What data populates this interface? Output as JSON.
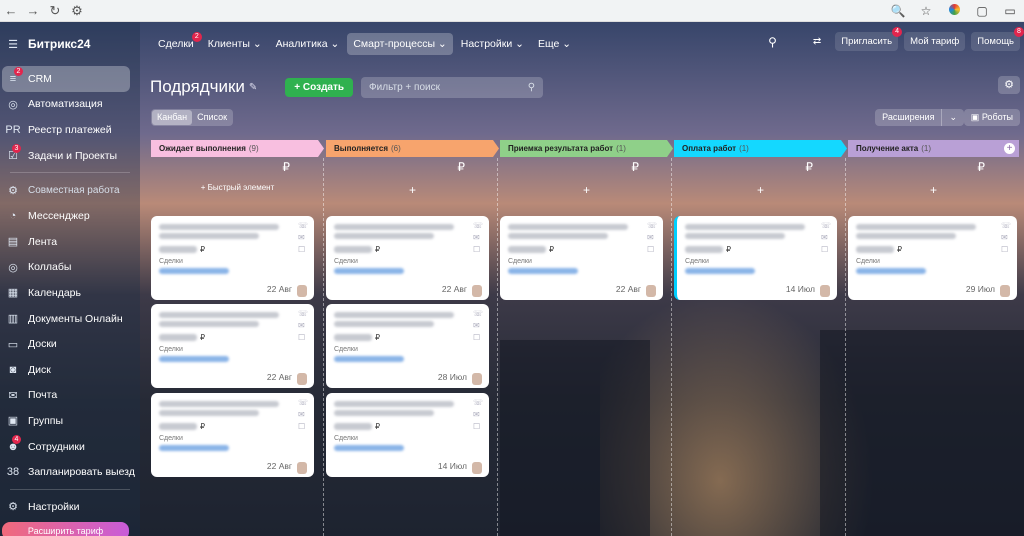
{
  "browser": {
    "back": "←",
    "forward": "→",
    "reload": "↻",
    "tune": "⚙",
    "zoom": "🔍",
    "star": "☆",
    "puzzle": "▢",
    "panel": "▭"
  },
  "logo": "Битрикс24",
  "sidebar": {
    "items": [
      {
        "label": "CRM",
        "icon": "≡",
        "badge": "2"
      },
      {
        "label": "Автоматизация",
        "icon": "◎",
        "badge": ""
      },
      {
        "label": "Реестр платежей",
        "icon": "PR",
        "badge": ""
      },
      {
        "label": "Задачи и Проекты",
        "icon": "☑",
        "badge": "3"
      }
    ],
    "section": "Совместная работа",
    "items2": [
      {
        "label": "Мессенджер",
        "icon": "◔"
      },
      {
        "label": "Лента",
        "icon": "▤"
      },
      {
        "label": "Коллабы",
        "icon": "◎"
      },
      {
        "label": "Календарь",
        "icon": "▦"
      },
      {
        "label": "Документы Онлайн",
        "icon": "▥"
      },
      {
        "label": "Доски",
        "icon": "▭"
      },
      {
        "label": "Диск",
        "icon": "◙"
      },
      {
        "label": "Почта",
        "icon": "✉"
      },
      {
        "label": "Группы",
        "icon": "▣"
      },
      {
        "label": "Сотрудники",
        "icon": "☻",
        "badge": "4"
      },
      {
        "label": "Запланировать выезд",
        "icon": "38"
      }
    ],
    "settings": "Настройки",
    "upgrade": "Расширить тариф"
  },
  "topmenu": [
    {
      "label": "Сделки",
      "badge": "2"
    },
    {
      "label": "Клиенты ⌄",
      "badge": ""
    },
    {
      "label": "Аналитика ⌄",
      "badge": ""
    },
    {
      "label": "Смарт-процессы ⌄",
      "badge": "",
      "selected": true
    },
    {
      "label": "Настройки ⌄",
      "badge": ""
    },
    {
      "label": "Еще ⌄",
      "badge": ""
    }
  ],
  "topright": {
    "invite": "Пригласить",
    "invite_badge": "4",
    "tariff": "Мой тариф",
    "help": "Помощь",
    "help_badge": "8"
  },
  "page": {
    "title": "Подрядчики",
    "create": "+ Создать",
    "filter_placeholder": "Фильтр + поиск"
  },
  "views": {
    "kanban": "Канбан",
    "list": "Список"
  },
  "extensions": {
    "label": "Расширения",
    "robots": "Роботы"
  },
  "columns": [
    {
      "name": "Ожидает выполнения",
      "count": "(9)",
      "color": "#f8bfe0",
      "quick": "+ Быстрый элемент",
      "dates": [
        "22 Авг",
        "22 Авг",
        "22 Авг"
      ]
    },
    {
      "name": "Выполняется",
      "count": "(6)",
      "color": "#f7a46d",
      "quick": "+",
      "dates": [
        "22 Авг",
        "28 Июл",
        "14 Июл"
      ]
    },
    {
      "name": "Приемка результата работ",
      "count": "(1)",
      "color": "#8fd089",
      "quick": "+",
      "dates": [
        "22 Авг"
      ]
    },
    {
      "name": "Оплата работ",
      "count": "(1)",
      "color": "#14d8ff",
      "quick": "+",
      "dates": [
        "14 Июл"
      ]
    },
    {
      "name": "Получение акта",
      "count": "(1)",
      "color": "#b9a0d6",
      "quick": "+",
      "dates": [
        "29 Июл"
      ]
    }
  ],
  "card": {
    "currency": "₽",
    "entity": "Сделки"
  }
}
